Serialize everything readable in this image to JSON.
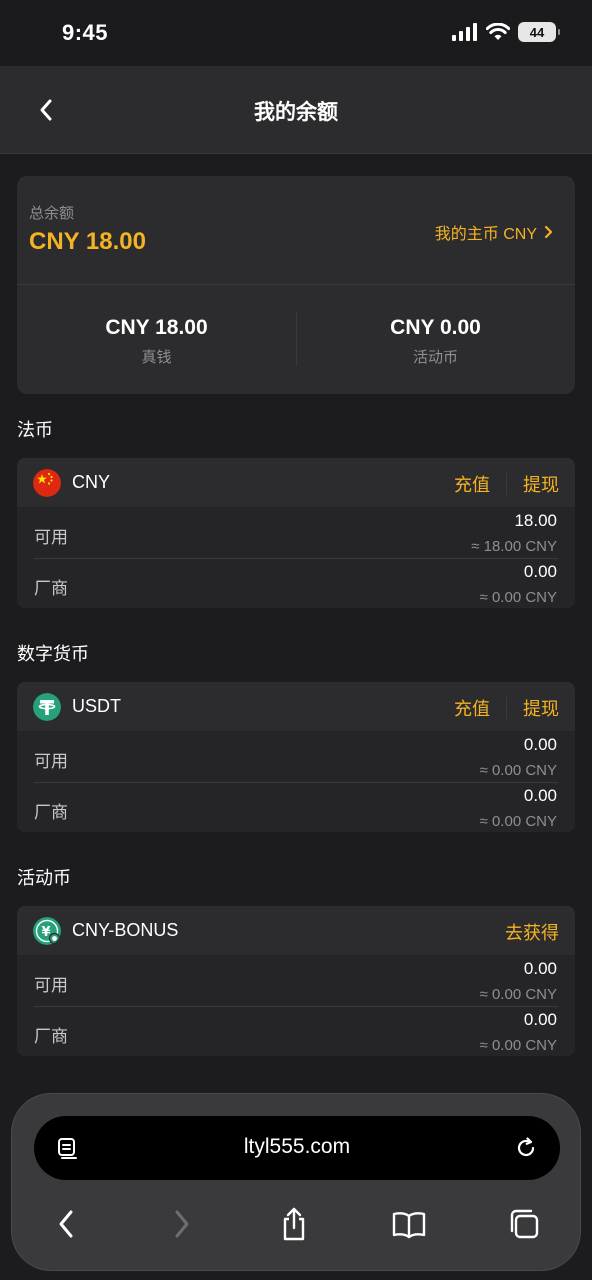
{
  "status": {
    "time": "9:45",
    "battery": "44"
  },
  "nav": {
    "title": "我的余额"
  },
  "total": {
    "label": "总余额",
    "value": "CNY 18.00",
    "main_currency": "我的主币 CNY",
    "real_value": "CNY 18.00",
    "real_label": "真钱",
    "bonus_value": "CNY 0.00",
    "bonus_label": "活动币"
  },
  "sections": {
    "fiat": {
      "title": "法币",
      "currency": "CNY",
      "deposit": "充值",
      "withdraw": "提现",
      "rows": [
        {
          "label": "可用",
          "amount": "18.00",
          "approx": "≈ 18.00 CNY"
        },
        {
          "label": "厂商",
          "amount": "0.00",
          "approx": "≈ 0.00 CNY"
        }
      ]
    },
    "crypto": {
      "title": "数字货币",
      "currency": "USDT",
      "deposit": "充值",
      "withdraw": "提现",
      "rows": [
        {
          "label": "可用",
          "amount": "0.00",
          "approx": "≈ 0.00 CNY"
        },
        {
          "label": "厂商",
          "amount": "0.00",
          "approx": "≈ 0.00 CNY"
        }
      ]
    },
    "bonus": {
      "title": "活动币",
      "currency": "CNY-BONUS",
      "get": "去获得",
      "rows": [
        {
          "label": "可用",
          "amount": "0.00",
          "approx": "≈ 0.00 CNY"
        },
        {
          "label": "厂商",
          "amount": "0.00",
          "approx": "≈ 0.00 CNY"
        }
      ]
    }
  },
  "browser": {
    "url": "ltyl555.com"
  },
  "colors": {
    "accent": "#f5b323",
    "usdt": "#26a17b",
    "cny_flag": "#de2910"
  }
}
